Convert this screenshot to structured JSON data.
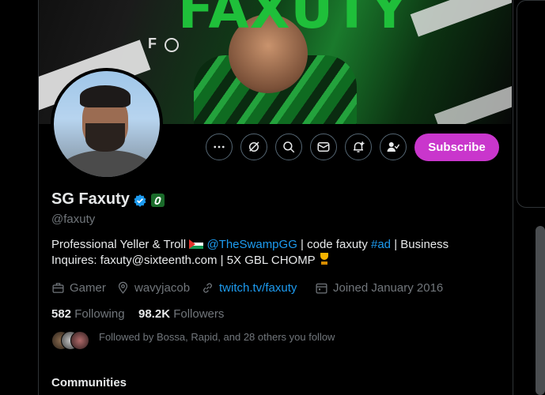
{
  "banner": {
    "title": "FAXUTY",
    "logo_letter": "F"
  },
  "profile": {
    "display_name": "SG Faxuty",
    "handle": "@faxuty",
    "bio_part1": "Professional Yeller & Troll",
    "bio_mention": "@TheSwampGG",
    "bio_part2": " | code faxuty",
    "bio_hashtag": "#ad",
    "bio_part3": " | Business Inquires: faxuty@sixteenth.com | 5X GBL CHOMP",
    "category": "Gamer",
    "location": "wavyjacob",
    "website": "twitch.tv/faxuty",
    "joined": "Joined January 2016",
    "following_count": "582",
    "following_label": "Following",
    "followers_count": "98.2K",
    "followers_label": "Followers",
    "followed_by_text": "Followed by Bossa, Rapid, and 28 others you follow"
  },
  "actions": {
    "more": "more-icon",
    "grok": "grok-icon",
    "search": "search-icon",
    "message": "message-icon",
    "notify": "notification-bell-icon",
    "follow": "following-check-icon",
    "subscribe_label": "Subscribe"
  },
  "section": {
    "communities_label": "Communities"
  },
  "colors": {
    "accent": "#1d9bf0",
    "subscribe": "#c936cc",
    "muted": "#71767b",
    "text": "#e7e9ea"
  }
}
